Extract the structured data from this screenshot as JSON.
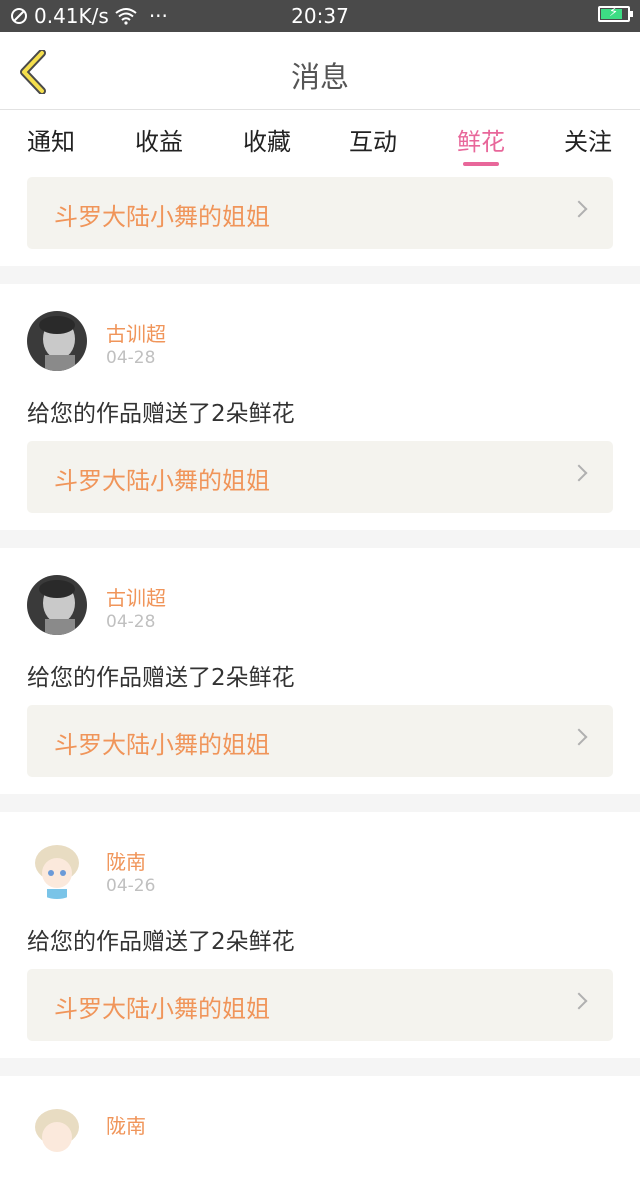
{
  "status_bar": {
    "network_speed": "0.41K/s",
    "more": "···",
    "time": "20:37",
    "battery_level": 0.8
  },
  "header": {
    "title": "消息"
  },
  "tabs": [
    {
      "label": "通知"
    },
    {
      "label": "收益"
    },
    {
      "label": "收藏"
    },
    {
      "label": "互动"
    },
    {
      "label": "鲜花",
      "active": true
    },
    {
      "label": "关注"
    }
  ],
  "top_link": {
    "label": "斗罗大陆小舞的姐姐"
  },
  "items": [
    {
      "user": "古训超",
      "date": "04-28",
      "message": "给您的作品赠送了2朵鲜花",
      "link": "斗罗大陆小舞的姐姐"
    },
    {
      "user": "古训超",
      "date": "04-28",
      "message": "给您的作品赠送了2朵鲜花",
      "link": "斗罗大陆小舞的姐姐"
    },
    {
      "user": "陇南",
      "date": "04-26",
      "message": "给您的作品赠送了2朵鲜花",
      "link": "斗罗大陆小舞的姐姐"
    },
    {
      "user": "陇南"
    }
  ],
  "colors": {
    "accent": "#e8679a",
    "username": "#f0955a",
    "status_bar": "#4a4a4a",
    "link_box": "#f4f3ee"
  }
}
